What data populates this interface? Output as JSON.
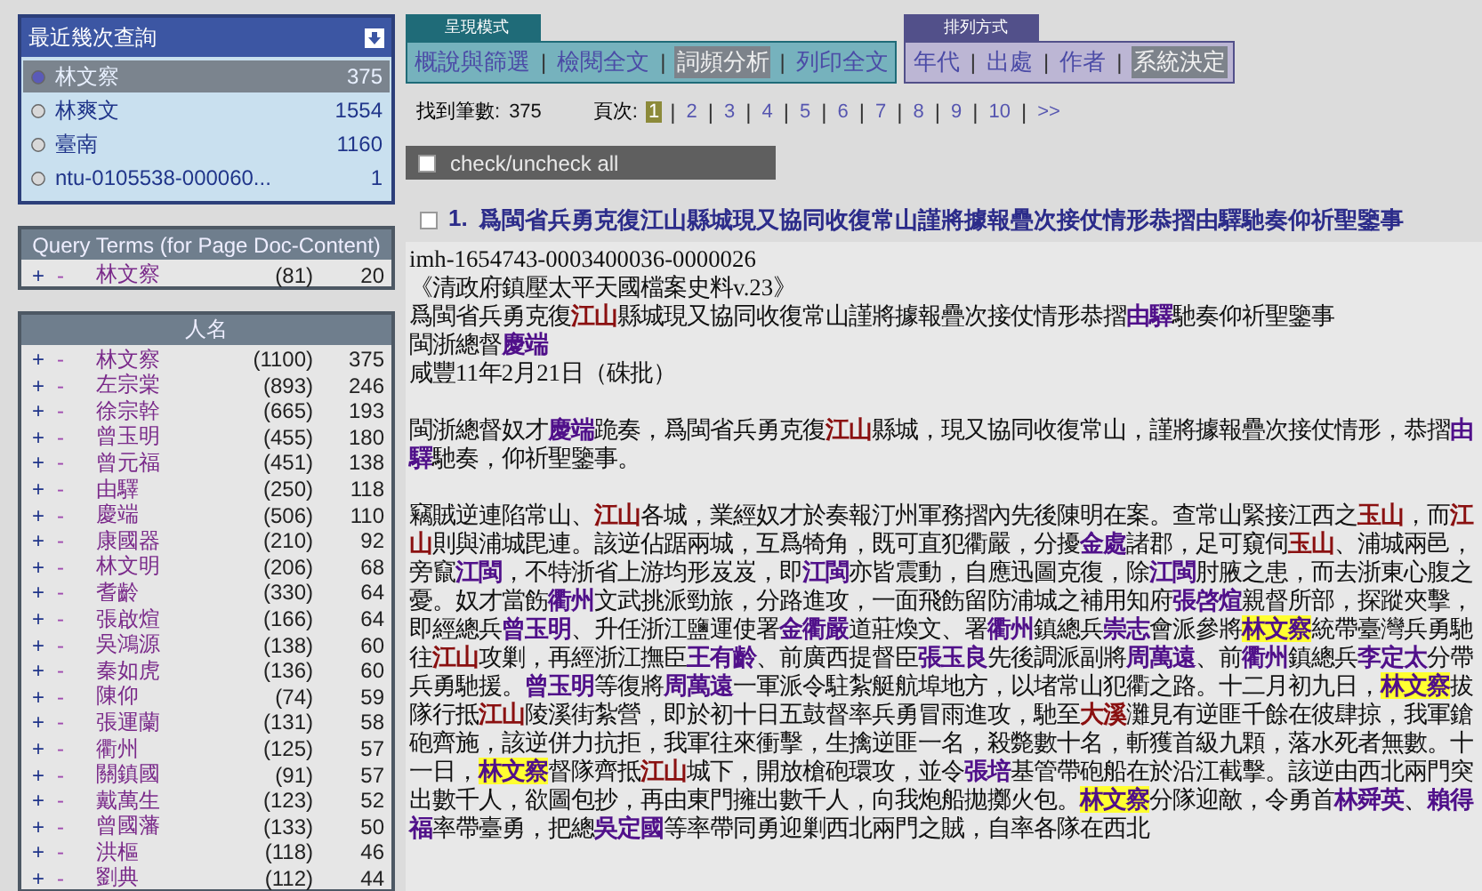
{
  "recent_queries": {
    "title": "最近幾次查詢",
    "items": [
      {
        "label": "林文察",
        "count": "375",
        "selected": true
      },
      {
        "label": "林爽文",
        "count": "1554",
        "selected": false
      },
      {
        "label": "臺南",
        "count": "1160",
        "selected": false
      },
      {
        "label": "ntu-0105538-000060...",
        "count": "1",
        "selected": false
      }
    ]
  },
  "query_terms": {
    "title": "Query Terms (for Page Doc-Content)",
    "rows": [
      {
        "plus": "+",
        "minus": "-",
        "term": "林文察",
        "total": "(81)",
        "count": "20"
      }
    ]
  },
  "names": {
    "title": "人名",
    "rows": [
      {
        "plus": "+",
        "minus": "-",
        "term": "林文察",
        "total": "(1100)",
        "count": "375"
      },
      {
        "plus": "+",
        "minus": "-",
        "term": "左宗棠",
        "total": "(893)",
        "count": "246"
      },
      {
        "plus": "+",
        "minus": "-",
        "term": "徐宗幹",
        "total": "(665)",
        "count": "193"
      },
      {
        "plus": "+",
        "minus": "-",
        "term": "曾玉明",
        "total": "(455)",
        "count": "180"
      },
      {
        "plus": "+",
        "minus": "-",
        "term": "曾元福",
        "total": "(451)",
        "count": "138"
      },
      {
        "plus": "+",
        "minus": "-",
        "term": "由驛",
        "total": "(250)",
        "count": "118"
      },
      {
        "plus": "+",
        "minus": "-",
        "term": "慶端",
        "total": "(506)",
        "count": "110"
      },
      {
        "plus": "+",
        "minus": "-",
        "term": "康國器",
        "total": "(210)",
        "count": "92"
      },
      {
        "plus": "+",
        "minus": "-",
        "term": "林文明",
        "total": "(206)",
        "count": "68"
      },
      {
        "plus": "+",
        "minus": "-",
        "term": "耆齡",
        "total": "(330)",
        "count": "64"
      },
      {
        "plus": "+",
        "minus": "-",
        "term": "張啟煊",
        "total": "(166)",
        "count": "64"
      },
      {
        "plus": "+",
        "minus": "-",
        "term": "吳鴻源",
        "total": "(138)",
        "count": "60"
      },
      {
        "plus": "+",
        "minus": "-",
        "term": "秦如虎",
        "total": "(136)",
        "count": "60"
      },
      {
        "plus": "+",
        "minus": "-",
        "term": "陳仰",
        "total": "(74)",
        "count": "59"
      },
      {
        "plus": "+",
        "minus": "-",
        "term": "張運蘭",
        "total": "(131)",
        "count": "58"
      },
      {
        "plus": "+",
        "minus": "-",
        "term": "衢州",
        "total": "(125)",
        "count": "57"
      },
      {
        "plus": "+",
        "minus": "-",
        "term": "關鎮國",
        "total": "(91)",
        "count": "57"
      },
      {
        "plus": "+",
        "minus": "-",
        "term": "戴萬生",
        "total": "(123)",
        "count": "52"
      },
      {
        "plus": "+",
        "minus": "-",
        "term": "曾國藩",
        "total": "(133)",
        "count": "50"
      },
      {
        "plus": "+",
        "minus": "-",
        "term": "洪樞",
        "total": "(118)",
        "count": "46"
      },
      {
        "plus": "+",
        "minus": "-",
        "term": "劉典",
        "total": "(112)",
        "count": "44"
      }
    ]
  },
  "display_mode": {
    "title": "呈現模式",
    "separator": "|",
    "tabs": [
      {
        "label": "概說與篩選",
        "selected": false
      },
      {
        "label": "檢閱全文",
        "selected": false
      },
      {
        "label": "詞頻分析",
        "selected": true
      },
      {
        "label": "列印全文",
        "selected": false
      }
    ]
  },
  "sort_mode": {
    "title": "排列方式",
    "separator": "|",
    "tabs": [
      {
        "label": "年代",
        "selected": false
      },
      {
        "label": "出處",
        "selected": false
      },
      {
        "label": "作者",
        "selected": false
      },
      {
        "label": "系統決定",
        "selected": true
      }
    ]
  },
  "results": {
    "found_label": "找到筆數:",
    "found": "375",
    "page_label": "頁次:",
    "separator": "|",
    "pages": [
      {
        "label": "1",
        "selected": true
      },
      {
        "label": "2",
        "selected": false
      },
      {
        "label": "3",
        "selected": false
      },
      {
        "label": "4",
        "selected": false
      },
      {
        "label": "5",
        "selected": false
      },
      {
        "label": "6",
        "selected": false
      },
      {
        "label": "7",
        "selected": false
      },
      {
        "label": "8",
        "selected": false
      },
      {
        "label": "9",
        "selected": false
      },
      {
        "label": "10",
        "selected": false
      },
      {
        "label": ">>",
        "selected": false
      }
    ]
  },
  "check_all": {
    "label": "check/uncheck all",
    "checked": false
  },
  "document": {
    "number": "1.",
    "title": "爲閩省兵勇克復江山縣城現又協同收復常山謹將據報疊次接仗情形恭摺由驛馳奏仰祈聖鑒事",
    "checked": false,
    "meta": [
      [
        {
          "kind": "plain",
          "text": "imh-1654743-0003400036-0000026"
        }
      ],
      [
        {
          "kind": "plain",
          "text": "《清政府鎮壓太平天國檔案史料v.23》"
        }
      ],
      [
        {
          "kind": "plain",
          "text": "爲閩省兵勇克復"
        },
        {
          "kind": "place",
          "text": "江山"
        },
        {
          "kind": "plain",
          "text": "縣城現又協同收復常山謹將據報疊次接仗情形恭摺"
        },
        {
          "kind": "person",
          "text": "由驛"
        },
        {
          "kind": "plain",
          "text": "馳奏仰祈聖鑒事"
        }
      ],
      [
        {
          "kind": "plain",
          "text": "閩浙總督"
        },
        {
          "kind": "person",
          "text": "慶端"
        }
      ],
      [
        {
          "kind": "plain",
          "text": "咸豐11年2月21日（硃批）"
        }
      ]
    ],
    "paragraphs": [
      [
        {
          "kind": "plain",
          "text": "閩浙總督奴才"
        },
        {
          "kind": "person",
          "text": "慶端"
        },
        {
          "kind": "plain",
          "text": "跪奏，爲閩省兵勇克復"
        },
        {
          "kind": "place",
          "text": "江山"
        },
        {
          "kind": "plain",
          "text": "縣城，現又協同收復常山，謹將據報疊次接仗情形，恭摺"
        },
        {
          "kind": "person",
          "text": "由驛"
        },
        {
          "kind": "plain",
          "text": "馳奏，仰祈聖鑒事。"
        }
      ],
      [
        {
          "kind": "plain",
          "text": "竊賊逆連陷常山、"
        },
        {
          "kind": "place",
          "text": "江山"
        },
        {
          "kind": "plain",
          "text": "各城，業經奴才於奏報汀州軍務摺內先後陳明在案。查常山緊接江西之"
        },
        {
          "kind": "place",
          "text": "玉山"
        },
        {
          "kind": "plain",
          "text": "，而"
        },
        {
          "kind": "place",
          "text": "江山"
        },
        {
          "kind": "plain",
          "text": "則與浦城毘連。該逆佔踞兩城，互爲犄角，既可直犯衢嚴，分擾"
        },
        {
          "kind": "person",
          "text": "金處"
        },
        {
          "kind": "plain",
          "text": "諸郡，足可窺伺"
        },
        {
          "kind": "place",
          "text": "玉山"
        },
        {
          "kind": "plain",
          "text": "、浦城兩邑，旁竄"
        },
        {
          "kind": "person",
          "text": "江閩"
        },
        {
          "kind": "plain",
          "text": "，不特浙省上游均形岌岌，即"
        },
        {
          "kind": "person",
          "text": "江閩"
        },
        {
          "kind": "plain",
          "text": "亦皆震動，自應迅圖克復，除"
        },
        {
          "kind": "person",
          "text": "江閩"
        },
        {
          "kind": "plain",
          "text": "肘腋之患，而去浙東心腹之憂。奴才當飭"
        },
        {
          "kind": "person",
          "text": "衢州"
        },
        {
          "kind": "plain",
          "text": "文武挑派勁旅，分路進攻，一面飛飭留防浦城之補用知府"
        },
        {
          "kind": "person",
          "text": "張啓煊"
        },
        {
          "kind": "plain",
          "text": "親督所部，探蹤夾擊，即經總兵"
        },
        {
          "kind": "person",
          "text": "曾玉明"
        },
        {
          "kind": "plain",
          "text": "、升任浙江鹽運使署"
        },
        {
          "kind": "person",
          "text": "金衢嚴"
        },
        {
          "kind": "plain",
          "text": "道莊煥文、署"
        },
        {
          "kind": "person",
          "text": "衢州"
        },
        {
          "kind": "plain",
          "text": "鎮總兵"
        },
        {
          "kind": "person",
          "text": "崇志"
        },
        {
          "kind": "plain",
          "text": "會派參將"
        },
        {
          "kind": "query",
          "text": "林文察"
        },
        {
          "kind": "plain",
          "text": "統帶臺灣兵勇馳往"
        },
        {
          "kind": "place",
          "text": "江山"
        },
        {
          "kind": "plain",
          "text": "攻剿，再經浙江撫臣"
        },
        {
          "kind": "person",
          "text": "王有齡"
        },
        {
          "kind": "plain",
          "text": "、前廣西提督臣"
        },
        {
          "kind": "person",
          "text": "張玉良"
        },
        {
          "kind": "plain",
          "text": "先後調派副將"
        },
        {
          "kind": "person",
          "text": "周萬遠"
        },
        {
          "kind": "plain",
          "text": "、前"
        },
        {
          "kind": "person",
          "text": "衢州"
        },
        {
          "kind": "plain",
          "text": "鎮總兵"
        },
        {
          "kind": "person",
          "text": "李定太"
        },
        {
          "kind": "plain",
          "text": "分帶兵勇馳援。"
        },
        {
          "kind": "person",
          "text": "曾玉明"
        },
        {
          "kind": "plain",
          "text": "等復將"
        },
        {
          "kind": "person",
          "text": "周萬遠"
        },
        {
          "kind": "plain",
          "text": "一軍派令駐紮艇航埠地方，以堵常山犯衢之路。十二月初九日，"
        },
        {
          "kind": "query",
          "text": "林文察"
        },
        {
          "kind": "plain",
          "text": "拔隊行抵"
        },
        {
          "kind": "place",
          "text": "江山"
        },
        {
          "kind": "plain",
          "text": "陵溪街紮營，即於初十日五鼓督率兵勇冒雨進攻，馳至"
        },
        {
          "kind": "place",
          "text": "大溪"
        },
        {
          "kind": "plain",
          "text": "灘見有逆匪千餘在彼肆掠，我軍鎗砲齊施，該逆併力抗拒，我軍往來衝擊，生擒逆匪一名，殺斃數十名，斬獲首級九顆，落水死者無數。十一日，"
        },
        {
          "kind": "query",
          "text": "林文察"
        },
        {
          "kind": "plain",
          "text": "督隊齊抵"
        },
        {
          "kind": "place",
          "text": "江山"
        },
        {
          "kind": "plain",
          "text": "城下，開放槍砲環攻，並令"
        },
        {
          "kind": "person",
          "text": "張培"
        },
        {
          "kind": "plain",
          "text": "基管帶砲船在於沿江截擊。該逆由西北兩門突出數千人，欲圖包抄，再由東門擁出數千人，向我炮船拋擲火包。"
        },
        {
          "kind": "query",
          "text": "林文察"
        },
        {
          "kind": "plain",
          "text": "分隊迎敵，令勇首"
        },
        {
          "kind": "person",
          "text": "林舜英"
        },
        {
          "kind": "plain",
          "text": "、"
        },
        {
          "kind": "person",
          "text": "賴得福"
        },
        {
          "kind": "plain",
          "text": "率帶臺勇，把總"
        },
        {
          "kind": "person",
          "text": "吳定國"
        },
        {
          "kind": "plain",
          "text": "等率帶同勇迎剿西北兩門之賊，自率各隊在西北"
        }
      ]
    ]
  }
}
